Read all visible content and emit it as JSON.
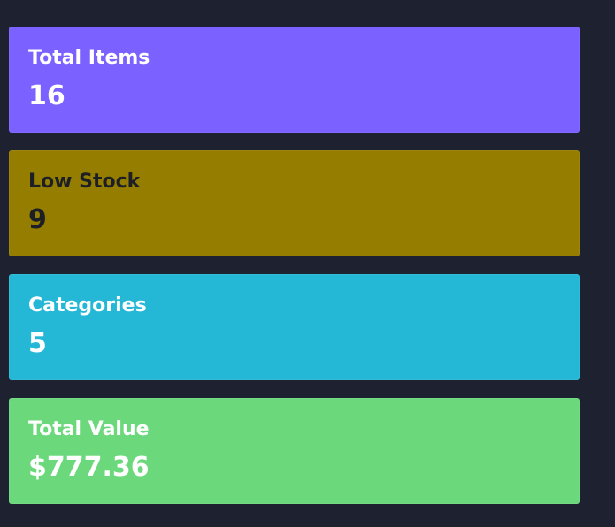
{
  "stats": {
    "total_items": {
      "label": "Total Items",
      "value": "16",
      "color": "#7b61ff"
    },
    "low_stock": {
      "label": "Low Stock",
      "value": "9",
      "color": "#957d00"
    },
    "categories": {
      "label": "Categories",
      "value": "5",
      "color": "#25b8d6"
    },
    "total_value": {
      "label": "Total Value",
      "value": "$777.36",
      "color": "#6cd87c"
    }
  },
  "theme": {
    "background": "#1e2230"
  }
}
